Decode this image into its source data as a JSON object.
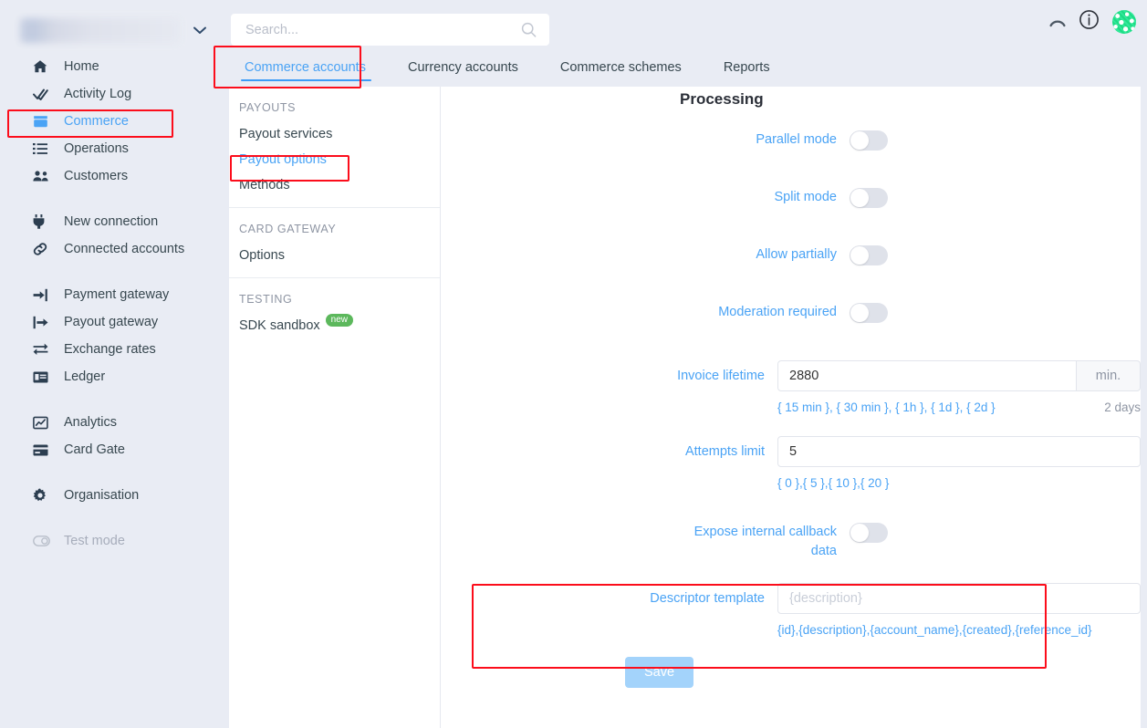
{
  "sidebar": {
    "org_switcher": {
      "name": "",
      "caret_icon": "chevron-down-icon"
    },
    "items": [
      {
        "label": "Home",
        "icon": "home-icon",
        "state": "normal"
      },
      {
        "label": "Activity Log",
        "icon": "checks-icon",
        "state": "normal"
      },
      {
        "label": "Commerce",
        "icon": "store-icon",
        "state": "active"
      },
      {
        "label": "Operations",
        "icon": "list-icon",
        "state": "normal"
      },
      {
        "label": "Customers",
        "icon": "users-icon",
        "state": "normal"
      },
      {
        "label": "New connection",
        "icon": "plug-icon",
        "state": "normal"
      },
      {
        "label": "Connected accounts",
        "icon": "link-icon",
        "state": "normal"
      },
      {
        "label": "Payment gateway",
        "icon": "sign-in-icon",
        "state": "normal"
      },
      {
        "label": "Payout gateway",
        "icon": "sign-out-icon",
        "state": "normal"
      },
      {
        "label": "Exchange rates",
        "icon": "exchange-icon",
        "state": "normal"
      },
      {
        "label": "Ledger",
        "icon": "ledger-card-icon",
        "state": "normal"
      },
      {
        "label": "Analytics",
        "icon": "chart-line-icon",
        "state": "normal"
      },
      {
        "label": "Card Gate",
        "icon": "credit-card-icon",
        "state": "normal"
      },
      {
        "label": "Organisation",
        "icon": "gear-icon",
        "state": "normal"
      },
      {
        "label": "Test mode",
        "icon": "toggle-icon",
        "state": "muted"
      }
    ]
  },
  "topbar": {
    "search_placeholder": "Search...",
    "search_value": "",
    "search_icon": "search-icon",
    "collapse_icon": "chevron-up-icon",
    "info_icon": "info-circle-icon",
    "avatar_icon": "avatar"
  },
  "tabs": [
    {
      "label": "Commerce accounts",
      "active": true
    },
    {
      "label": "Currency accounts",
      "active": false
    },
    {
      "label": "Commerce schemes",
      "active": false
    },
    {
      "label": "Reports",
      "active": false
    }
  ],
  "subnav": [
    {
      "title": "PAYOUTS",
      "items": [
        {
          "label": "Payout services",
          "active": false,
          "badge": ""
        },
        {
          "label": "Payout options",
          "active": true,
          "badge": ""
        },
        {
          "label": "Methods",
          "active": false,
          "badge": ""
        }
      ]
    },
    {
      "title": "CARD GATEWAY",
      "items": [
        {
          "label": "Options",
          "active": false,
          "badge": ""
        }
      ]
    },
    {
      "title": "TESTING",
      "items": [
        {
          "label": "SDK sandbox",
          "active": false,
          "badge": "new"
        }
      ]
    }
  ],
  "form": {
    "title": "Processing",
    "parallel_mode": {
      "label": "Parallel mode",
      "value": "off"
    },
    "split_mode": {
      "label": "Split mode",
      "value": "off"
    },
    "allow_partially": {
      "label": "Allow partially",
      "value": "off"
    },
    "moderation_required": {
      "label": "Moderation required",
      "value": "off"
    },
    "invoice_lifetime": {
      "label": "Invoice lifetime",
      "value": "2880",
      "suffix": "min.",
      "presets": "{ 15 min }, { 30 min }, { 1h }, { 1d }, { 2d }",
      "computed": "2 days"
    },
    "attempts_limit": {
      "label": "Attempts limit",
      "value": "5",
      "presets": "{ 0 },{ 5 },{ 10 },{ 20 }"
    },
    "expose_internal_callback": {
      "label_line1": "Expose internal callback",
      "label_line2": "data",
      "value": "off"
    },
    "descriptor_template": {
      "label": "Descriptor template",
      "value": "",
      "placeholder": "{description}",
      "presets": "{id},{description},{account_name},{created},{reference_id}"
    },
    "save_label": "Save"
  },
  "colors": {
    "accent_blue": "#4aa3f5",
    "page_bg": "#e9ecf4",
    "highlight_red": "#fc0d1b",
    "badge_green": "#5cb85c",
    "save_button": "#a3d3fb"
  }
}
